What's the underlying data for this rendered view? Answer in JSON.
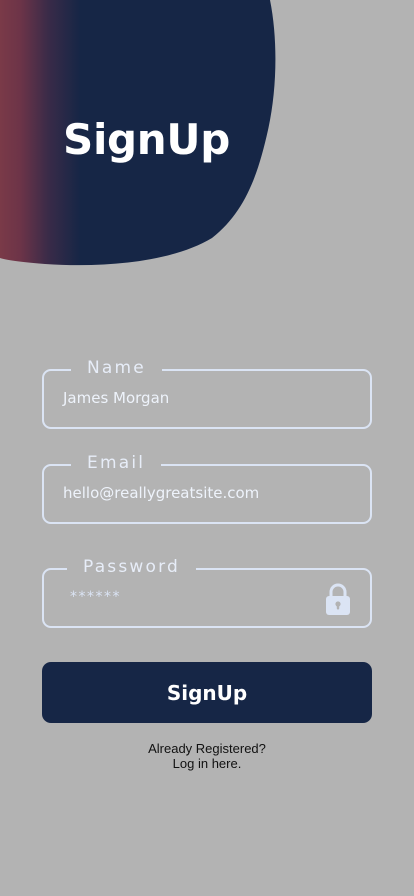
{
  "header": {
    "title": "SignUp"
  },
  "form": {
    "name": {
      "label": "Name",
      "value": "James Morgan"
    },
    "email": {
      "label": "Email",
      "value": "hello@reallygreatsite.com"
    },
    "password": {
      "label": "Password",
      "value": "******"
    },
    "submit_label": "SignUp"
  },
  "footer": {
    "line1": "Already Registered?",
    "line2": "Log in here."
  },
  "colors": {
    "background": "#b3b3b3",
    "navy": "#162646",
    "accent": "#7a3a48",
    "field_border": "#dbe4f4"
  },
  "icons": {
    "password": "lock-icon"
  }
}
